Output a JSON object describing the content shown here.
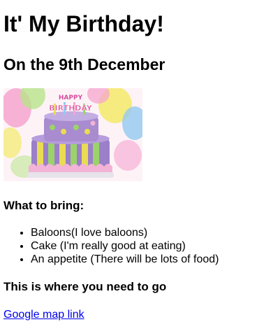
{
  "title": "It' My Birthday!",
  "date_heading": "On the 9th December",
  "image": {
    "topper_lines": [
      "HAPPY",
      "BIRTHDAY"
    ],
    "colors": {
      "cake_top": "#a98bd0",
      "cake_base": "#9b7fc8",
      "stripe_yellow": "#e9dc53",
      "stripe_green": "#9bd36a",
      "frill_pink": "#f2b3d6",
      "balloon_pink": "#f6a5cf",
      "balloon_yellow": "#f4e96a",
      "balloon_green": "#b8e38a",
      "balloon_blue": "#93c9f0"
    }
  },
  "bring": {
    "heading": "What to bring:",
    "items": [
      "Baloons(I love baloons)",
      "Cake (I'm really good at eating)",
      "An appetite (There will be lots of food)"
    ]
  },
  "where": {
    "heading": "This is where you need to go",
    "link_text": "Google map link"
  }
}
